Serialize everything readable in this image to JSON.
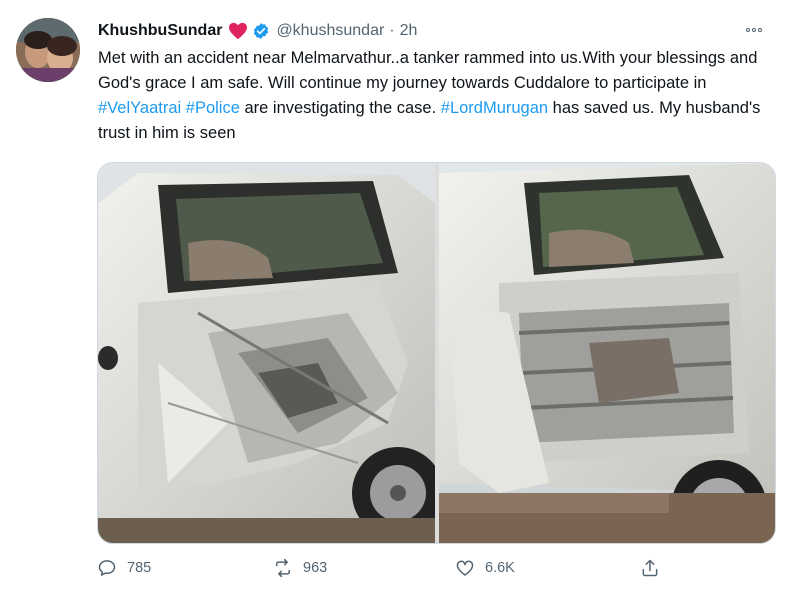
{
  "tweet": {
    "author_name": "KhushbuSundar",
    "handle": "@khushsundar",
    "separator": "·",
    "time": "2h",
    "text_parts": [
      "Met with an accident near Melmarvathur..a tanker rammed into us.With your blessings and God's grace I am safe. Will continue my journey towards Cuddalore to participate in ",
      "#VelYaatrai",
      " ",
      "#Police",
      " are investigating the case. ",
      "#LordMurugan",
      " has saved us. My husband's trust in him is seen"
    ]
  },
  "actions": {
    "reply_count": "785",
    "retweet_count": "963",
    "like_count": "6.6K"
  },
  "icons": {
    "heart_emoji": "red-heart-icon",
    "verified": "verified-badge-icon",
    "more": "more-options-icon",
    "reply": "reply-icon",
    "retweet": "retweet-icon",
    "like": "like-icon",
    "share": "share-icon"
  },
  "colors": {
    "hashtag": "#1d9bf0",
    "verified": "#1d9bf0",
    "heart": "#e0245e",
    "muted": "#536471"
  }
}
